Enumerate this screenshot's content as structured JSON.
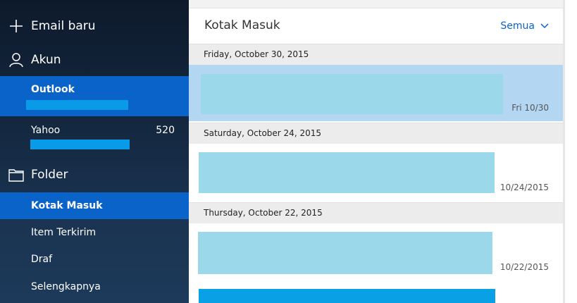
{
  "sidebar": {
    "new_email": "Email baru",
    "accounts_label": "Akun",
    "accounts": [
      {
        "name": "Outlook",
        "count": ""
      },
      {
        "name": "Yahoo",
        "count": "520"
      }
    ],
    "folders_label": "Folder",
    "folders": [
      "Kotak Masuk",
      "Item Terkirim",
      "Draf",
      "Selengkapnya"
    ]
  },
  "main": {
    "title": "Kotak Masuk",
    "filter": "Semua",
    "groups": [
      {
        "date_header": "Friday, October 30, 2015",
        "mail_date": "Fri 10/30"
      },
      {
        "date_header": "Saturday, October 24, 2015",
        "mail_date": "10/24/2015"
      },
      {
        "date_header": "Thursday, October 22, 2015",
        "mail_date": "10/22/2015"
      }
    ]
  },
  "colors": {
    "accent": "#0a63c9",
    "selected_mail": "#b3d6f2",
    "preview_placeholder": "#9bd8ea",
    "sidebar_bg": "#13253c"
  }
}
